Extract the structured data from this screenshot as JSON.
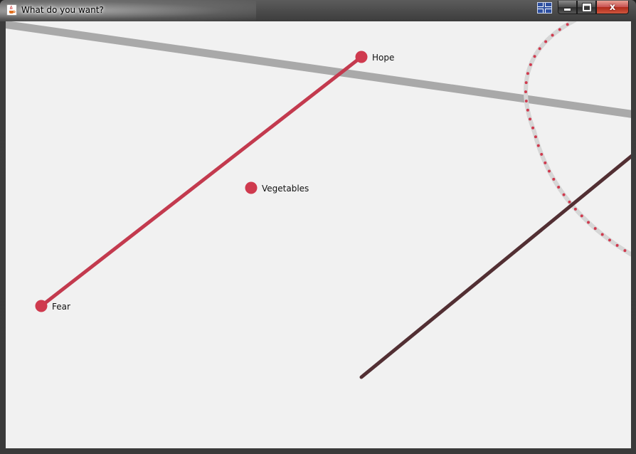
{
  "window": {
    "title": "What do you want?",
    "icon": "java-cup-icon"
  },
  "titlebar_controls": {
    "language_icon": "keyboard-language-icon",
    "minimize_icon": "minimize-icon",
    "maximize_icon": "maximize-icon",
    "close_icon": "close-icon",
    "close_glyph": "x"
  },
  "canvas": {
    "nodes": [
      {
        "id": "fear",
        "label": "Fear"
      },
      {
        "id": "vegetables",
        "label": "Vegetables"
      },
      {
        "id": "hope",
        "label": "Hope"
      }
    ],
    "colors": {
      "background": "#f1f1f1",
      "node": "#cf3a4e",
      "edge": "#c33a4e",
      "grey_line": "#a9a9a9",
      "dark_line": "#522f33",
      "arc_track": "#d6d6d6",
      "arc_dots": "#cf3a4e"
    }
  }
}
